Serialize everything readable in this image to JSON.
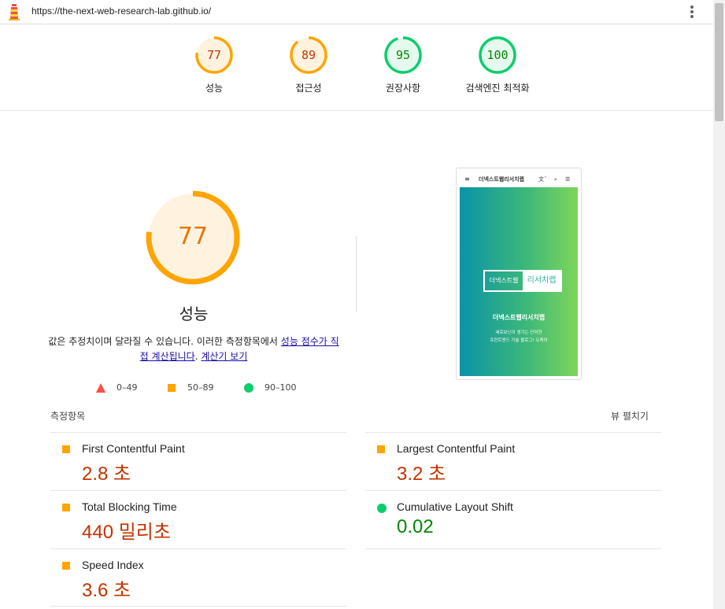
{
  "browser": {
    "url": "https://the-next-web-research-lab.github.io/",
    "menu_icon": "kebab-menu-icon"
  },
  "colors": {
    "average": "#ffa400",
    "average_text": "#c33300",
    "pass": "#0cce6b",
    "pass_text": "#008800",
    "fail": "#ff4e42"
  },
  "summary": [
    {
      "score": "77",
      "label": "성능",
      "status": "average"
    },
    {
      "score": "89",
      "label": "접근성",
      "status": "average"
    },
    {
      "score": "95",
      "label": "권장사항",
      "status": "pass"
    },
    {
      "score": "100",
      "label": "검색엔진 최적화",
      "status": "pass"
    }
  ],
  "performance": {
    "score": "77",
    "title": "성능",
    "desc_prefix": "값은 추정치이며 달라질 수 있습니다. 이러한 측정항목에서 ",
    "desc_link1": "성능 점수가 직접 계산됩니다",
    "desc_mid": ". ",
    "desc_link2": "계산기 보기",
    "legend": [
      {
        "range": "0–49",
        "shape": "triangle"
      },
      {
        "range": "50–89",
        "shape": "square"
      },
      {
        "range": "90–100",
        "shape": "circle"
      }
    ]
  },
  "screenshot": {
    "nav_title": "더넥스트웹리서치랩",
    "logo_left": "더넥스트웹",
    "logo_right": "리서치랩",
    "hero_title": "더넥스트웹리서치랩",
    "hero_sub1": "세로보닌이 생기는 단어한",
    "hero_sub2": "프런트엔드 기술 블로그! 오케이"
  },
  "metrics": {
    "header": "측정항목",
    "toggle": "뷰 펼치기",
    "items": [
      {
        "name": "First Contentful Paint",
        "value": "2.8 초",
        "status": "average"
      },
      {
        "name": "Largest Contentful Paint",
        "value": "3.2 초",
        "status": "average"
      },
      {
        "name": "Total Blocking Time",
        "value": "440 밀리초",
        "status": "average"
      },
      {
        "name": "Cumulative Layout Shift",
        "value": "0.02",
        "status": "pass"
      },
      {
        "name": "Speed Index",
        "value": "3.6 초",
        "status": "average"
      }
    ]
  }
}
